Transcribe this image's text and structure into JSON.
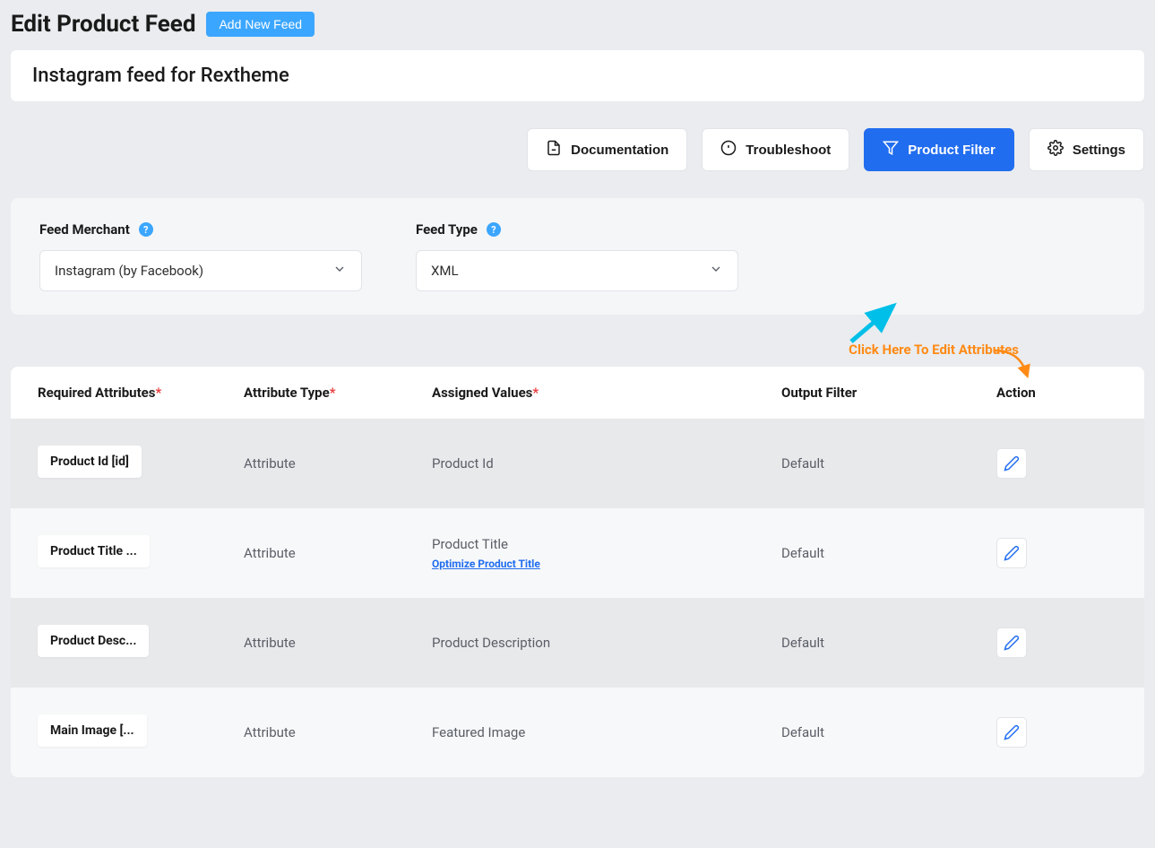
{
  "header": {
    "title": "Edit Product Feed",
    "add_button": "Add New Feed"
  },
  "feed_name": "Instagram feed for Rextheme",
  "toolbar": {
    "documentation": "Documentation",
    "troubleshoot": "Troubleshoot",
    "product_filter": "Product Filter",
    "settings": "Settings"
  },
  "config": {
    "merchant_label": "Feed Merchant",
    "merchant_value": "Instagram (by Facebook)",
    "type_label": "Feed Type",
    "type_value": "XML"
  },
  "edit_attrs_hint": "Click Here To Edit Attributes",
  "table": {
    "headers": {
      "required": "Required Attributes",
      "attr_type": "Attribute Type",
      "assigned": "Assigned Values",
      "output_filter": "Output Filter",
      "action": "Action"
    },
    "rows": [
      {
        "required": "Product Id [id]",
        "attr_type": "Attribute",
        "assigned": "Product Id",
        "optimize": "",
        "output_filter": "Default"
      },
      {
        "required": "Product Title ...",
        "attr_type": "Attribute",
        "assigned": "Product Title",
        "optimize": "Optimize Product Title",
        "output_filter": "Default"
      },
      {
        "required": "Product Desc...",
        "attr_type": "Attribute",
        "assigned": "Product Description",
        "optimize": "",
        "output_filter": "Default"
      },
      {
        "required": "Main Image [...",
        "attr_type": "Attribute",
        "assigned": "Featured Image",
        "optimize": "",
        "output_filter": "Default"
      }
    ]
  }
}
